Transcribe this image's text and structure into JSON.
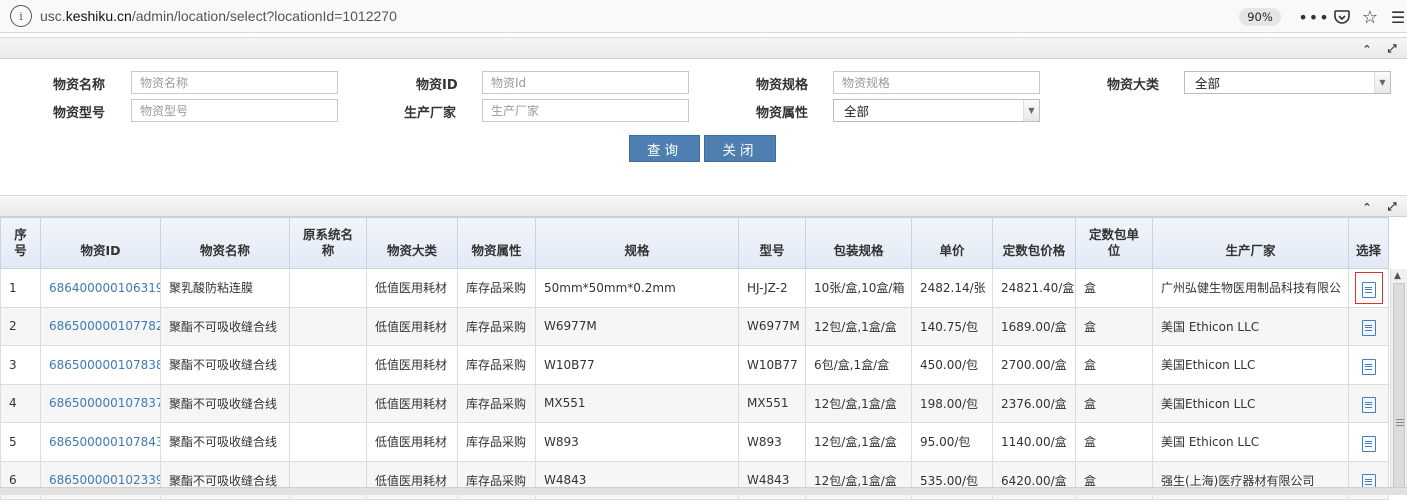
{
  "browser": {
    "url_prefix": "usc.",
    "url_host": "keshiku.cn",
    "url_path": "/admin/location/select?locationId=1012270",
    "zoom": "90%",
    "icons": [
      "info-icon",
      "more-icon",
      "pocket-icon",
      "bookmark-star-icon",
      "menu-icon"
    ]
  },
  "search_form": {
    "name_label": "物资名称",
    "name_placeholder": "物资名称",
    "id_label": "物资ID",
    "id_placeholder": "物资Id",
    "spec_label": "物资规格",
    "spec_placeholder": "物资规格",
    "category_label": "物资大类",
    "category_value": "全部",
    "model_label": "物资型号",
    "model_placeholder": "物资型号",
    "maker_label": "生产厂家",
    "maker_placeholder": "生产厂家",
    "attr_label": "物资属性",
    "attr_value": "全部",
    "query_button": "查询",
    "close_button": "关闭"
  },
  "table": {
    "headers": [
      "序号",
      "物资ID",
      "物资名称",
      "原系统名称",
      "物资大类",
      "物资属性",
      "规格",
      "型号",
      "包装规格",
      "单价",
      "定数包价格",
      "定数包单位",
      "生产厂家",
      "选择"
    ],
    "rows": [
      [
        "1",
        "686400000106319",
        "聚乳酸防粘连膜",
        "",
        "低值医用耗材",
        "库存品采购",
        "50mm*50mm*0.2mm",
        "HJ-JZ-2",
        "10张/盒,10盒/箱",
        "2482.14/张",
        "24821.40/盒",
        "盒",
        "广州弘健生物医用制品科技有限公"
      ],
      [
        "2",
        "686500000107782",
        "聚酯不可吸收缝合线",
        "",
        "低值医用耗材",
        "库存品采购",
        "W6977M",
        "W6977M",
        "12包/盒,1盒/盒",
        "140.75/包",
        "1689.00/盒",
        "盒",
        "美国 Ethicon LLC"
      ],
      [
        "3",
        "686500000107838",
        "聚酯不可吸收缝合线",
        "",
        "低值医用耗材",
        "库存品采购",
        "W10B77",
        "W10B77",
        "6包/盒,1盒/盒",
        "450.00/包",
        "2700.00/盒",
        "盒",
        "美国Ethicon LLC"
      ],
      [
        "4",
        "686500000107837",
        "聚酯不可吸收缝合线",
        "",
        "低值医用耗材",
        "库存品采购",
        "MX551",
        "MX551",
        "12包/盒,1盒/盒",
        "198.00/包",
        "2376.00/盒",
        "盒",
        "美国Ethicon LLC"
      ],
      [
        "5",
        "686500000107843",
        "聚酯不可吸收缝合线",
        "",
        "低值医用耗材",
        "库存品采购",
        "W893",
        "W893",
        "12包/盒,1盒/盒",
        "95.00/包",
        "1140.00/盒",
        "盒",
        "美国 Ethicon LLC"
      ],
      [
        "6",
        "686500000102339",
        "聚酯不可吸收缝合线",
        "",
        "低值医用耗材",
        "库存品采购",
        "W4843",
        "W4843",
        "12包/盒,1盒/盒",
        "535.00/包",
        "6420.00/盒",
        "盒",
        "强生(上海)医疗器材有限公司"
      ]
    ]
  },
  "colors": {
    "button": "#4e7fb0",
    "link": "#3f7ab5",
    "header_bg": "#e3eaf5",
    "selected_outline": "#d9352d"
  }
}
